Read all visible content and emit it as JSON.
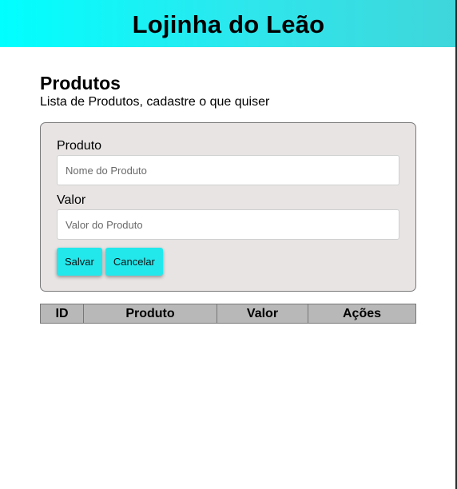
{
  "header": {
    "title": "Lojinha do Leão"
  },
  "page": {
    "title": "Produtos",
    "subtitle": "Lista de Produtos, cadastre o que quiser"
  },
  "form": {
    "product_label": "Produto",
    "product_placeholder": "Nome do Produto",
    "product_value": "",
    "price_label": "Valor",
    "price_placeholder": "Valor do Produto",
    "price_value": "",
    "save_label": "Salvar",
    "cancel_label": "Cancelar"
  },
  "table": {
    "columns": [
      "ID",
      "Produto",
      "Valor",
      "Ações"
    ],
    "rows": []
  },
  "colors": {
    "header_gradient_start": "#00ffff",
    "header_gradient_end": "#3fd6da",
    "button": "#22e8ec",
    "form_background": "#e8e4e4",
    "table_header": "#b8b8b8"
  }
}
